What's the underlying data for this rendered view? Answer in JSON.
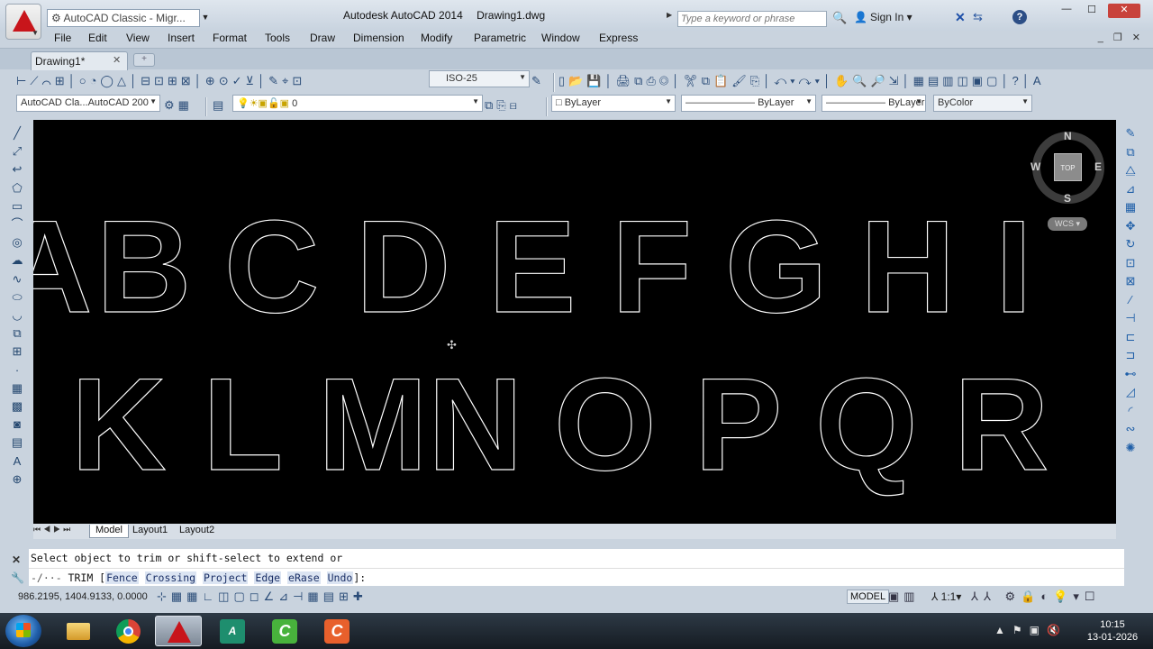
{
  "title_bar": {
    "workspace": "AutoCAD Classic - Migr...",
    "app_title": "Autodesk AutoCAD 2014",
    "file_title": "Drawing1.dwg",
    "search_placeholder": "Type a keyword or phrase",
    "sign_in": "Sign In"
  },
  "menu": [
    "File",
    "Edit",
    "View",
    "Insert",
    "Format",
    "Tools",
    "Draw",
    "Dimension",
    "Modify",
    "Parametric",
    "Window",
    "Express"
  ],
  "tabs": {
    "document": "Drawing1*"
  },
  "toolbars": {
    "dim_style": "ISO-25",
    "workspace_mini": "AutoCAD Cla...AutoCAD 200",
    "layer_value": "0",
    "color": "ByLayer",
    "linetype": "ByLayer",
    "lineweight": "ByLayer",
    "plotstyle": "ByColor"
  },
  "viewcube": {
    "north": "N",
    "south": "S",
    "east": "E",
    "west": "W",
    "top": "TOP",
    "ucs": "WCS"
  },
  "drawing": {
    "row1": [
      "A",
      "B",
      "C",
      "D",
      "E",
      "F",
      "G",
      "H",
      "I"
    ],
    "row2": [
      "K",
      "L",
      "M",
      "N",
      "O",
      "P",
      "Q",
      "R"
    ]
  },
  "layout_tabs": [
    "Model",
    "Layout1",
    "Layout2"
  ],
  "command_line": {
    "history": "Select object to trim or shift-select to extend or",
    "prompt_cmd": "TRIM",
    "options": [
      "Fence",
      "Crossing",
      "Project",
      "Edge",
      "eRase",
      "Undo"
    ]
  },
  "status": {
    "coordinates": "986.2195, 1404.9133, 0.0000",
    "model": "MODEL",
    "annotation_scale": "1:1"
  },
  "taskbar": {
    "time": "10:15",
    "date": "13-01-2026"
  }
}
